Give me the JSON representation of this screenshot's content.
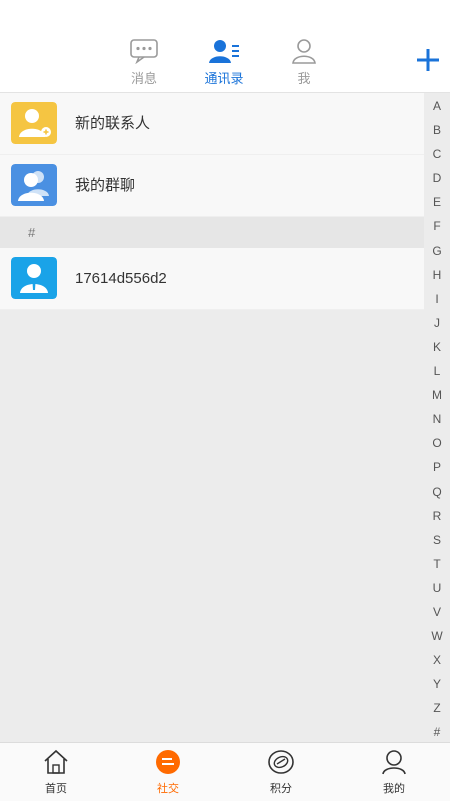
{
  "top_tabs": [
    {
      "label": "消息",
      "icon": "message-icon",
      "active": false
    },
    {
      "label": "通讯录",
      "icon": "contacts-icon",
      "active": true
    },
    {
      "label": "我",
      "icon": "person-icon",
      "active": false
    }
  ],
  "add_icon": "plus-icon",
  "rows_top": [
    {
      "name": "新的联系人",
      "icon": "new-contact-icon",
      "color": "#f5c542"
    },
    {
      "name": "我的群聊",
      "icon": "group-chat-icon",
      "color": "#4a90e2"
    }
  ],
  "section_header": "#",
  "contacts": [
    {
      "name": "17614d556d2",
      "icon": "user-avatar-icon",
      "color": "#1aa3e8"
    }
  ],
  "alphabet": [
    "A",
    "B",
    "C",
    "D",
    "E",
    "F",
    "G",
    "H",
    "I",
    "J",
    "K",
    "L",
    "M",
    "N",
    "O",
    "P",
    "Q",
    "R",
    "S",
    "T",
    "U",
    "V",
    "W",
    "X",
    "Y",
    "Z",
    "#"
  ],
  "bottom_nav": [
    {
      "label": "首页",
      "icon": "home-icon",
      "active": false
    },
    {
      "label": "社交",
      "icon": "social-icon",
      "active": true
    },
    {
      "label": "积分",
      "icon": "points-icon",
      "active": false
    },
    {
      "label": "我的",
      "icon": "mine-icon",
      "active": false
    }
  ],
  "colors": {
    "accent": "#1a73d9",
    "bottom_active": "#ff6a00"
  }
}
